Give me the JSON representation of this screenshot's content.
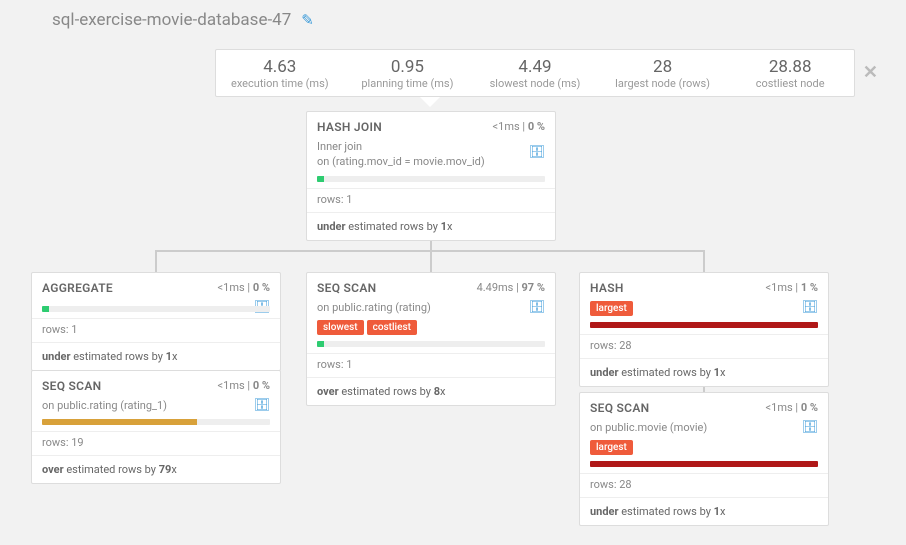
{
  "title": "sql-exercise-movie-database-47",
  "stats": [
    {
      "value": "4.63",
      "label": "execution time (ms)"
    },
    {
      "value": "0.95",
      "label": "planning time (ms)"
    },
    {
      "value": "4.49",
      "label": "slowest node (ms)"
    },
    {
      "value": "28",
      "label": "largest node (rows)"
    },
    {
      "value": "28.88",
      "label": "costliest node"
    }
  ],
  "nodes": {
    "root": {
      "op": "HASH JOIN",
      "ms": "<1ms",
      "pct": "0 %",
      "join_type": "Inner",
      "join_suffix": " join",
      "on_prefix": "on ",
      "on_cond": "(rating.mov_id = movie.mov_id)",
      "rows_prefix": "rows: ",
      "rows": "1",
      "est_dir": "under",
      "est_mid": " estimated rows by ",
      "est_x": "1",
      "est_suffix": "x",
      "bar_color": "#2ecc71",
      "bar_pct": 3
    },
    "agg": {
      "op": "AGGREGATE",
      "ms": "<1ms",
      "pct": "0 %",
      "rows_prefix": "rows: ",
      "rows": "1",
      "est_dir": "under",
      "est_mid": " estimated rows by ",
      "est_x": "1",
      "est_suffix": "x",
      "bar_color": "#2ecc71",
      "bar_pct": 3
    },
    "scan_rating1": {
      "op": "SEQ SCAN",
      "ms": "<1ms",
      "pct": "0 %",
      "on_prefix": "on ",
      "on_tbl": "public.rating (rating_1)",
      "rows_prefix": "rows: ",
      "rows": "19",
      "est_dir": "over",
      "est_mid": " estimated rows by ",
      "est_x": "79",
      "est_suffix": "x",
      "bar_color": "#d8a13a",
      "bar_pct": 68
    },
    "scan_rating": {
      "op": "SEQ SCAN",
      "ms": "4.49ms",
      "pct": "97 %",
      "on_prefix": "on ",
      "on_tbl": "public.rating (rating)",
      "badges": [
        "slowest",
        "costliest"
      ],
      "rows_prefix": "rows: ",
      "rows": "1",
      "est_dir": "over",
      "est_mid": " estimated rows by ",
      "est_x": "8",
      "est_suffix": "x",
      "bar_color": "#2ecc71",
      "bar_pct": 3
    },
    "hash": {
      "op": "HASH",
      "ms": "<1ms",
      "pct": "1 %",
      "badges": [
        "largest"
      ],
      "rows_prefix": "rows: ",
      "rows": "28",
      "est_dir": "under",
      "est_mid": " estimated rows by ",
      "est_x": "1",
      "est_suffix": "x",
      "bar_color": "#b01818",
      "bar_pct": 100
    },
    "scan_movie": {
      "op": "SEQ SCAN",
      "ms": "<1ms",
      "pct": "0 %",
      "on_prefix": "on ",
      "on_tbl": "public.movie (movie)",
      "badges": [
        "largest"
      ],
      "rows_prefix": "rows: ",
      "rows": "28",
      "est_dir": "under",
      "est_mid": " estimated rows by ",
      "est_x": "1",
      "est_suffix": "x",
      "bar_color": "#b01818",
      "bar_pct": 100
    }
  }
}
